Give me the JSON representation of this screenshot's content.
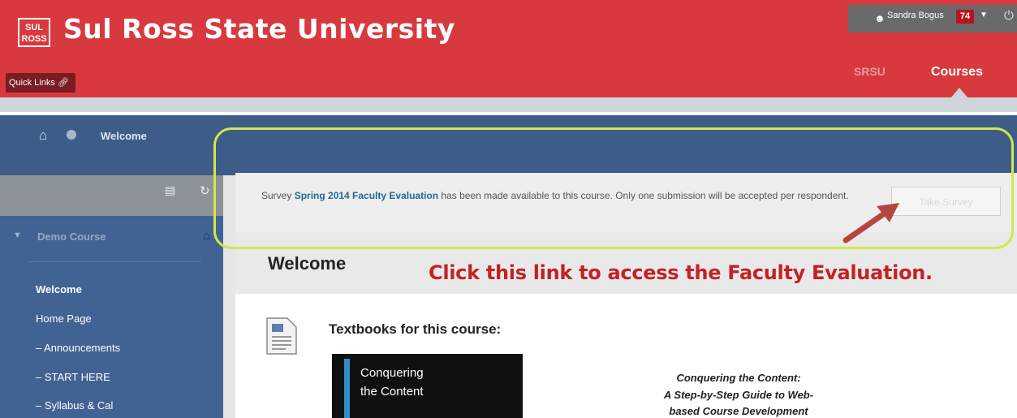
{
  "header": {
    "logo_text_1": "SUL",
    "logo_text_2": "ROSS",
    "title": "Sul Ross State University",
    "quick_links": "Quick Links",
    "user_name": "Sandra Bogus",
    "notification_count": "74",
    "tabs": [
      {
        "label": "SRSU"
      },
      {
        "label": "Courses"
      }
    ]
  },
  "breadcrumb": {
    "current": "Welcome"
  },
  "sidebar": {
    "course_title": "Demo Course",
    "items": [
      {
        "label": "Welcome"
      },
      {
        "label": "Home Page"
      },
      {
        "label": "– Announcements"
      },
      {
        "label": "– START HERE"
      },
      {
        "label": "– Syllabus & Cal"
      }
    ]
  },
  "notification": {
    "prefix": "Survey ",
    "survey_name": "Spring 2014 Faculty Evaluation",
    "suffix": " has been made available to this course. Only one submission will be accepted per respondent.",
    "button_label": "Take Survey"
  },
  "main": {
    "heading": "Welcome",
    "annotation": "Click this link to access the Faculty Evaluation.",
    "textbooks_heading": "Textbooks for this course:",
    "book_cover_line_1": "Conquering",
    "book_cover_line_2": "the Content",
    "book_desc_1": "Conquering the Content:",
    "book_desc_2": "A Step-by-Step Guide to Web-",
    "book_desc_3": "based Course Development"
  },
  "colors": {
    "header_red": "#d8393f",
    "nav_blue": "#3d5c88",
    "annotation_red": "#c42126",
    "highlight_yellow": "#d4e64a",
    "link_blue": "#206a92"
  },
  "icons": [
    "logo-icon",
    "user-icon",
    "caret-down-icon",
    "power-icon",
    "home-icon",
    "circle-icon",
    "folder-icon",
    "refresh-icon",
    "triangle-down-icon",
    "document-icon",
    "arrow-annotation-icon"
  ]
}
